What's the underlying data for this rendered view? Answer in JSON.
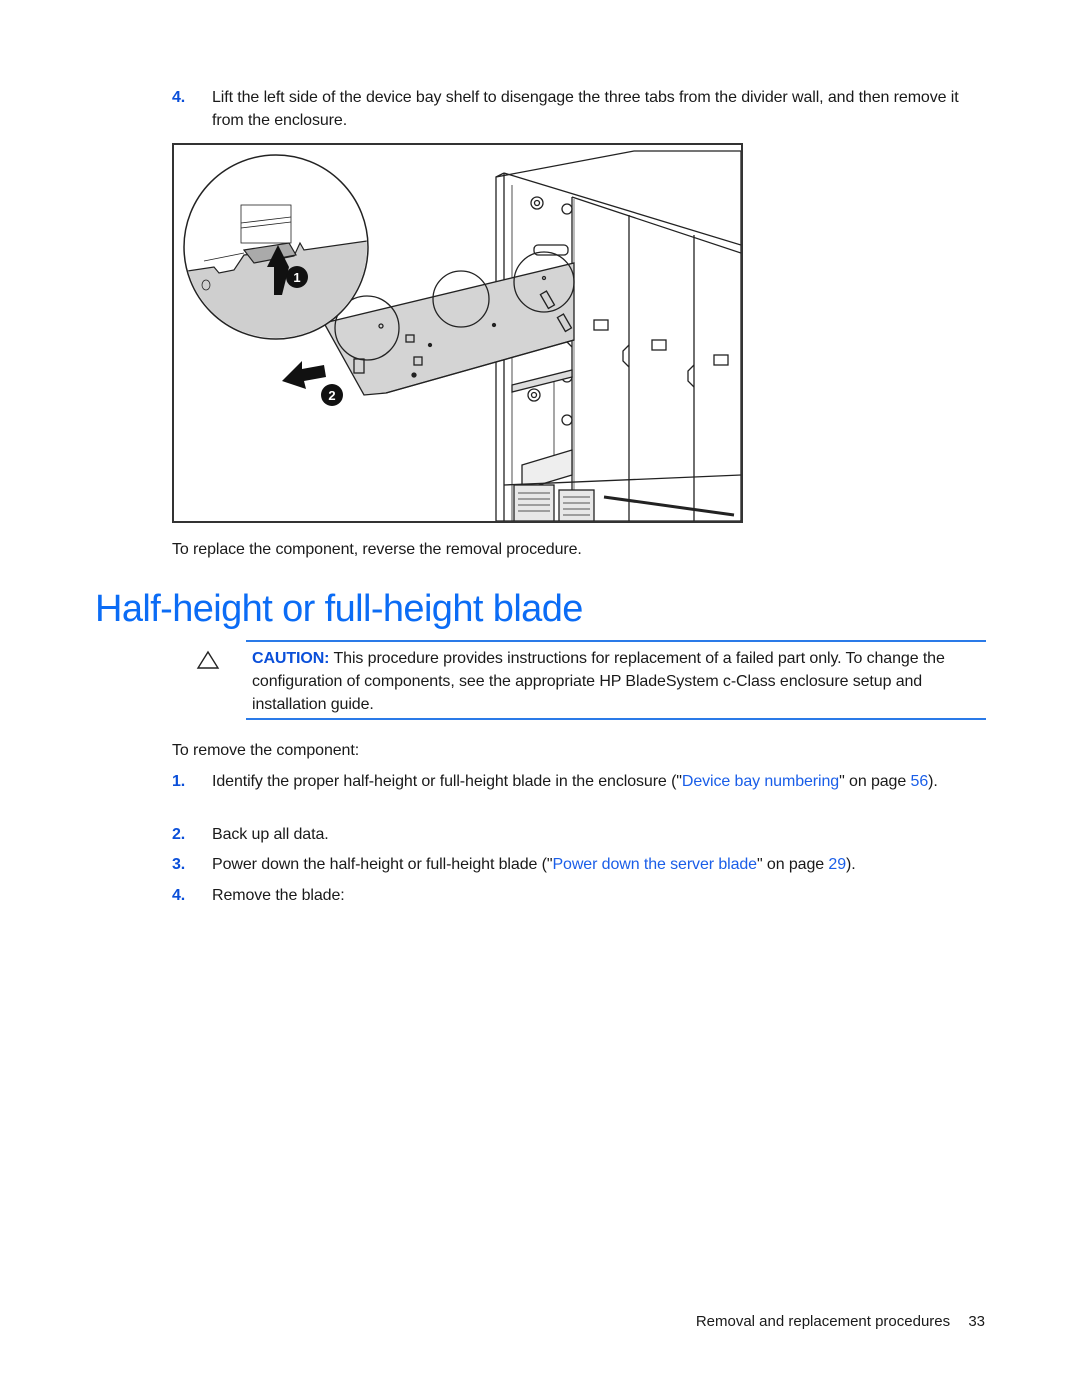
{
  "top_step": {
    "number": "4.",
    "text": "Lift the left side of the device bay shelf to disengage the three tabs from the divider wall, and then remove it from the enclosure."
  },
  "figure": {
    "description": "Device bay shelf removal illustration",
    "callouts": [
      "1",
      "2"
    ]
  },
  "replace_note": "To replace the component, reverse the removal procedure.",
  "section": {
    "heading": "Half-height or full-height blade"
  },
  "caution": {
    "icon": "caution-triangle-icon",
    "label": "CAUTION:",
    "text": "This procedure provides instructions for replacement of a failed part only. To change the configuration of components, see the appropriate HP BladeSystem c-Class enclosure setup and installation guide."
  },
  "intro": "To remove the component:",
  "steps": [
    {
      "number": "1.",
      "before": "Identify the proper half-height or full-height blade in the enclosure (\"",
      "link": "Device bay numbering",
      "middle": "\" on page ",
      "page": "56",
      "after": ")."
    },
    {
      "number": "2.",
      "text": "Back up all data."
    },
    {
      "number": "3.",
      "before": "Power down the half-height or full-height blade (\"",
      "link": "Power down the server blade",
      "middle": "\" on page ",
      "page": "29",
      "after": ")."
    },
    {
      "number": "4.",
      "text": "Remove the blade:"
    }
  ],
  "footer": {
    "section_title": "Removal and replacement procedures",
    "page_number": "33"
  },
  "colors": {
    "heading": "#0b6cf5",
    "accent": "#0a4fd9",
    "link": "#1a5ee8",
    "rule": "#2a7ae8"
  }
}
